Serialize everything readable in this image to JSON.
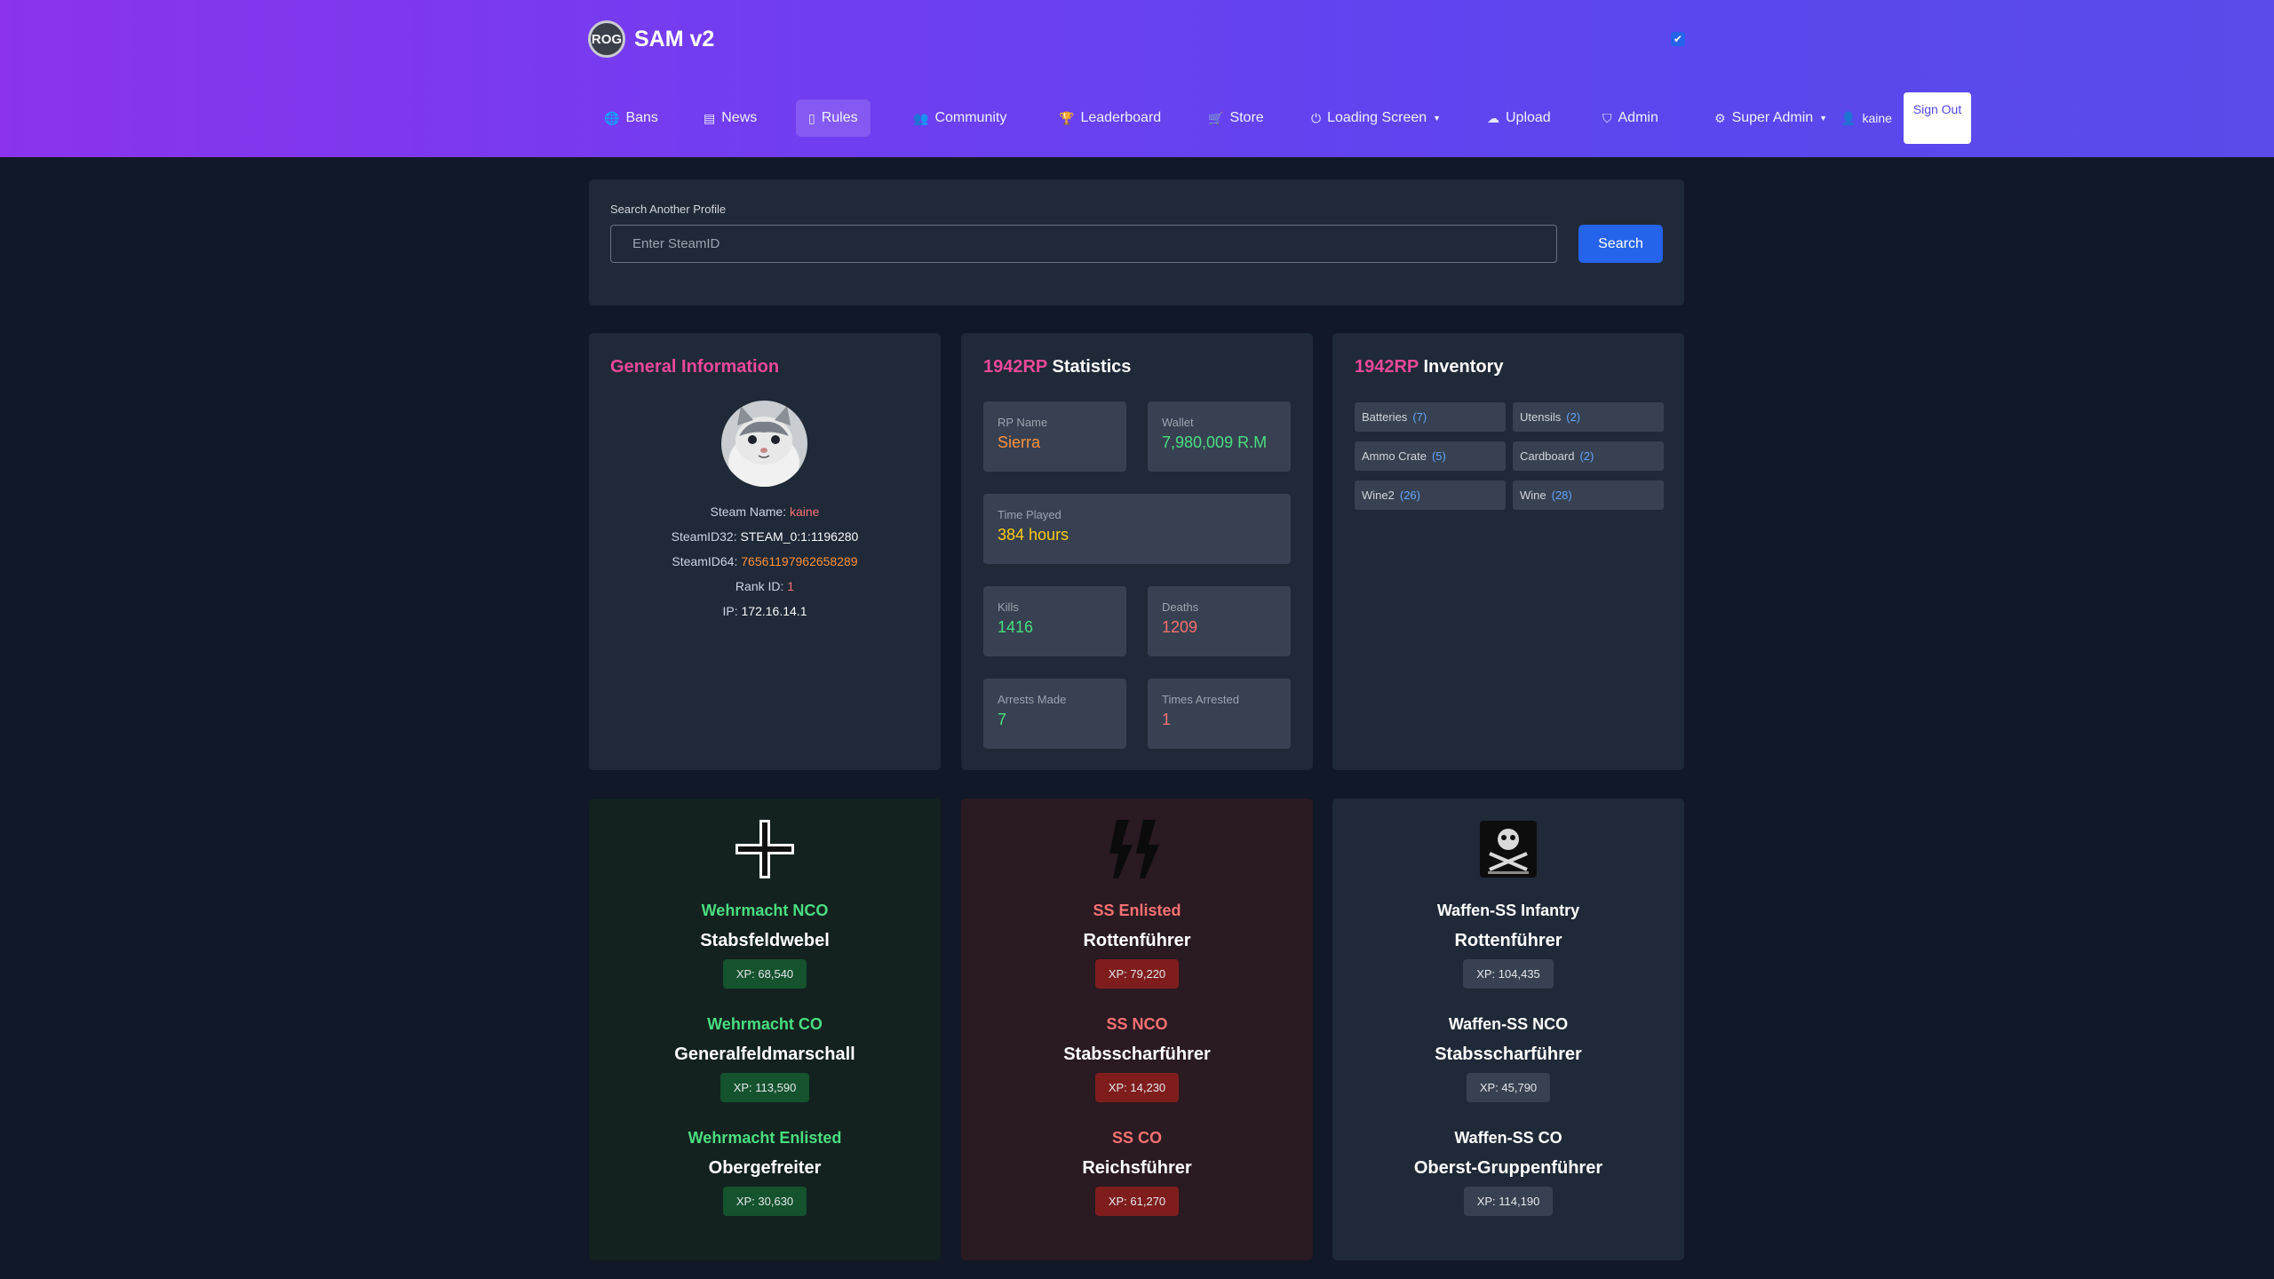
{
  "brand": {
    "logo_text": "ROG",
    "title": "SAM v2"
  },
  "nav": [
    {
      "label": "Bans",
      "icon": "globe-icon"
    },
    {
      "label": "News",
      "icon": "newspaper-icon"
    },
    {
      "label": "Rules",
      "icon": "document-icon",
      "active": true
    },
    {
      "label": "Community",
      "icon": "users-icon"
    },
    {
      "label": "Leaderboard",
      "icon": "trophy-icon"
    },
    {
      "label": "Store",
      "icon": "cart-icon"
    },
    {
      "label": "Loading Screen",
      "icon": "power-icon",
      "dropdown": true
    },
    {
      "label": "Upload",
      "icon": "cloud-upload-icon"
    },
    {
      "label": "Admin",
      "icon": "shield-icon"
    },
    {
      "label": "Super Admin",
      "icon": "gear-icon",
      "dropdown": true
    }
  ],
  "user": {
    "name": "kaine",
    "signout_label": "Sign Out"
  },
  "search": {
    "label": "Search Another Profile",
    "placeholder": "Enter SteamID",
    "button": "Search"
  },
  "general": {
    "title": "General Information",
    "steam_name_label": "Steam Name:",
    "steam_name": "kaine",
    "steamid32_label": "SteamID32:",
    "steamid32": "STEAM_0:1:1196280",
    "steamid64_label": "SteamID64:",
    "steamid64": "76561197962658289",
    "rank_label": "Rank ID:",
    "rank": "1",
    "ip_label": "IP:",
    "ip": "172.16.14.1"
  },
  "statistics": {
    "title_prefix": "1942RP",
    "title_suffix": "Statistics",
    "rp_name_label": "RP Name",
    "rp_name": "Sierra",
    "wallet_label": "Wallet",
    "wallet": "7,980,009 R.M",
    "time_label": "Time Played",
    "time": "384 hours",
    "kills_label": "Kills",
    "kills": "1416",
    "deaths_label": "Deaths",
    "deaths": "1209",
    "arrests_label": "Arrests Made",
    "arrests": "7",
    "arrested_label": "Times Arrested",
    "arrested": "1"
  },
  "inventory": {
    "title_prefix": "1942RP",
    "title_suffix": "Inventory",
    "items": [
      {
        "name": "Batteries",
        "count": "(7)"
      },
      {
        "name": "Utensils",
        "count": "(2)"
      },
      {
        "name": "Ammo Crate",
        "count": "(5)"
      },
      {
        "name": "Cardboard",
        "count": "(2)"
      },
      {
        "name": "Wine2",
        "count": "(26)"
      },
      {
        "name": "Wine",
        "count": "(28)"
      }
    ]
  },
  "factions": [
    {
      "emblem": "balkenkreuz-icon",
      "theme": "green",
      "entries": [
        {
          "name": "Wehrmacht NCO",
          "rank": "Stabsfeldwebel",
          "xp": "XP: 68,540"
        },
        {
          "name": "Wehrmacht CO",
          "rank": "Generalfeldmarschall",
          "xp": "XP: 113,590"
        },
        {
          "name": "Wehrmacht Enlisted",
          "rank": "Obergefreiter",
          "xp": "XP: 30,630"
        }
      ]
    },
    {
      "emblem": "ss-runes-icon",
      "theme": "red",
      "entries": [
        {
          "name": "SS Enlisted",
          "rank": "Rottenführer",
          "xp": "XP: 79,220"
        },
        {
          "name": "SS NCO",
          "rank": "Stabsscharführer",
          "xp": "XP: 14,230"
        },
        {
          "name": "SS CO",
          "rank": "Reichsführer",
          "xp": "XP: 61,270"
        }
      ]
    },
    {
      "emblem": "waffen-ss-badge-icon",
      "theme": "white",
      "entries": [
        {
          "name": "Waffen-SS Infantry",
          "rank": "Rottenführer",
          "xp": "XP: 104,435"
        },
        {
          "name": "Waffen-SS NCO",
          "rank": "Stabsscharführer",
          "xp": "XP: 45,790"
        },
        {
          "name": "Waffen-SS CO",
          "rank": "Oberst-Gruppenführer",
          "xp": "XP: 114,190"
        }
      ]
    }
  ],
  "colors": {
    "accent": "#ec4899",
    "primary": "#2563eb",
    "header_start": "#8b33ee",
    "header_end": "#5b4bea"
  }
}
